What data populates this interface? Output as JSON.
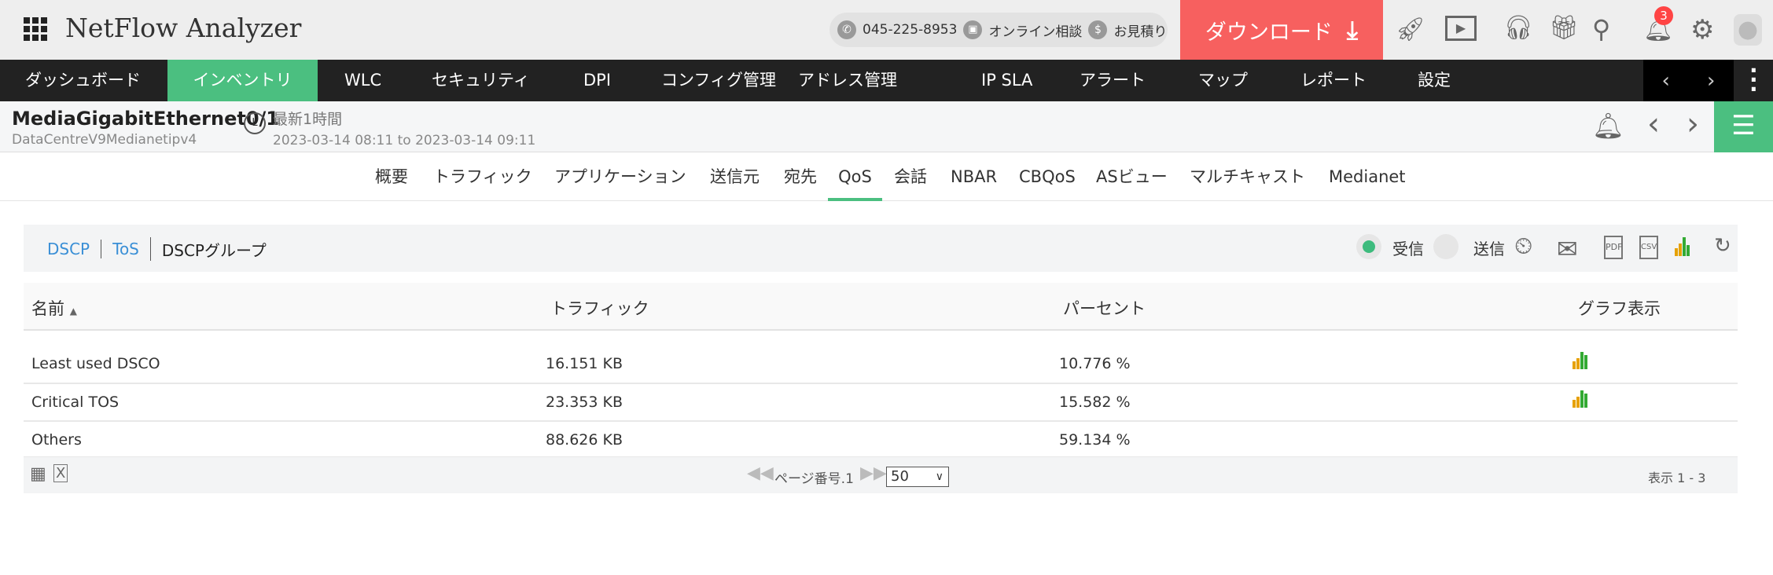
{
  "header": {
    "app_title": "NetFlow Analyzer",
    "phone": "045-225-8953",
    "consult": "オンライン相談",
    "quote": "お見積り",
    "download": "ダウンロード",
    "notification_count": "3"
  },
  "nav": {
    "items": [
      "ダッシュボード",
      "インベントリ",
      "WLC",
      "セキュリティ",
      "DPI",
      "コンフィグ管理",
      "アドレス管理",
      "IP SLA",
      "アラート",
      "マップ",
      "レポート",
      "設定"
    ],
    "active": "インベントリ"
  },
  "subheader": {
    "interface": "MediaGigabitEthernet0/1",
    "device": "DataCentreV9Medianetipv4",
    "period": "最新1時間",
    "range": "2023-03-14 08:11 to 2023-03-14 09:11"
  },
  "tabs": [
    "概要",
    "トラフィック",
    "アプリケーション",
    "送信元",
    "宛先",
    "QoS",
    "会話",
    "NBAR",
    "CBQoS",
    "ASビュー",
    "マルチキャスト",
    "Medianet"
  ],
  "panel": {
    "links": [
      "DSCP",
      "ToS"
    ],
    "current": "DSCPグループ",
    "in_label": "受信",
    "out_label": "送信"
  },
  "table": {
    "headers": [
      "名前",
      "トラフィック",
      "パーセント",
      "グラフ表示"
    ],
    "rows": [
      {
        "name": "Least used DSCO",
        "traffic": "16.151 KB",
        "percent": "10.776 %",
        "graph": true
      },
      {
        "name": "Critical TOS",
        "traffic": "23.353 KB",
        "percent": "15.582 %",
        "graph": true
      },
      {
        "name": "Others",
        "traffic": "88.626 KB",
        "percent": "59.134 %",
        "graph": false
      }
    ]
  },
  "footer": {
    "page_label": "ページ番号.1",
    "page_size": "50",
    "showing": "表示 1 - 3"
  },
  "colors": {
    "accent": "#4bbf80",
    "download": "#f7605f",
    "nav_bg": "#222222",
    "link": "#3a8fd6"
  }
}
